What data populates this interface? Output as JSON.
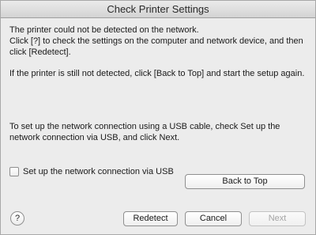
{
  "window": {
    "title": "Check Printer Settings"
  },
  "message": {
    "paragraph1": "The printer could not be detected on the network.\nClick [?] to check the settings on the computer and network device, and then click [Redetect].",
    "paragraph2": "If the printer is still not detected, click [Back to Top] and start the setup again.",
    "paragraph3": "To set up the network connection using a USB cable, check Set up the network connection via USB, and click Next."
  },
  "usb_option": {
    "label": "Set up the network connection via USB",
    "checked": false
  },
  "buttons": {
    "back_to_top": "Back to Top",
    "help": "?",
    "redetect": "Redetect",
    "cancel": "Cancel",
    "next": "Next",
    "next_enabled": false
  }
}
